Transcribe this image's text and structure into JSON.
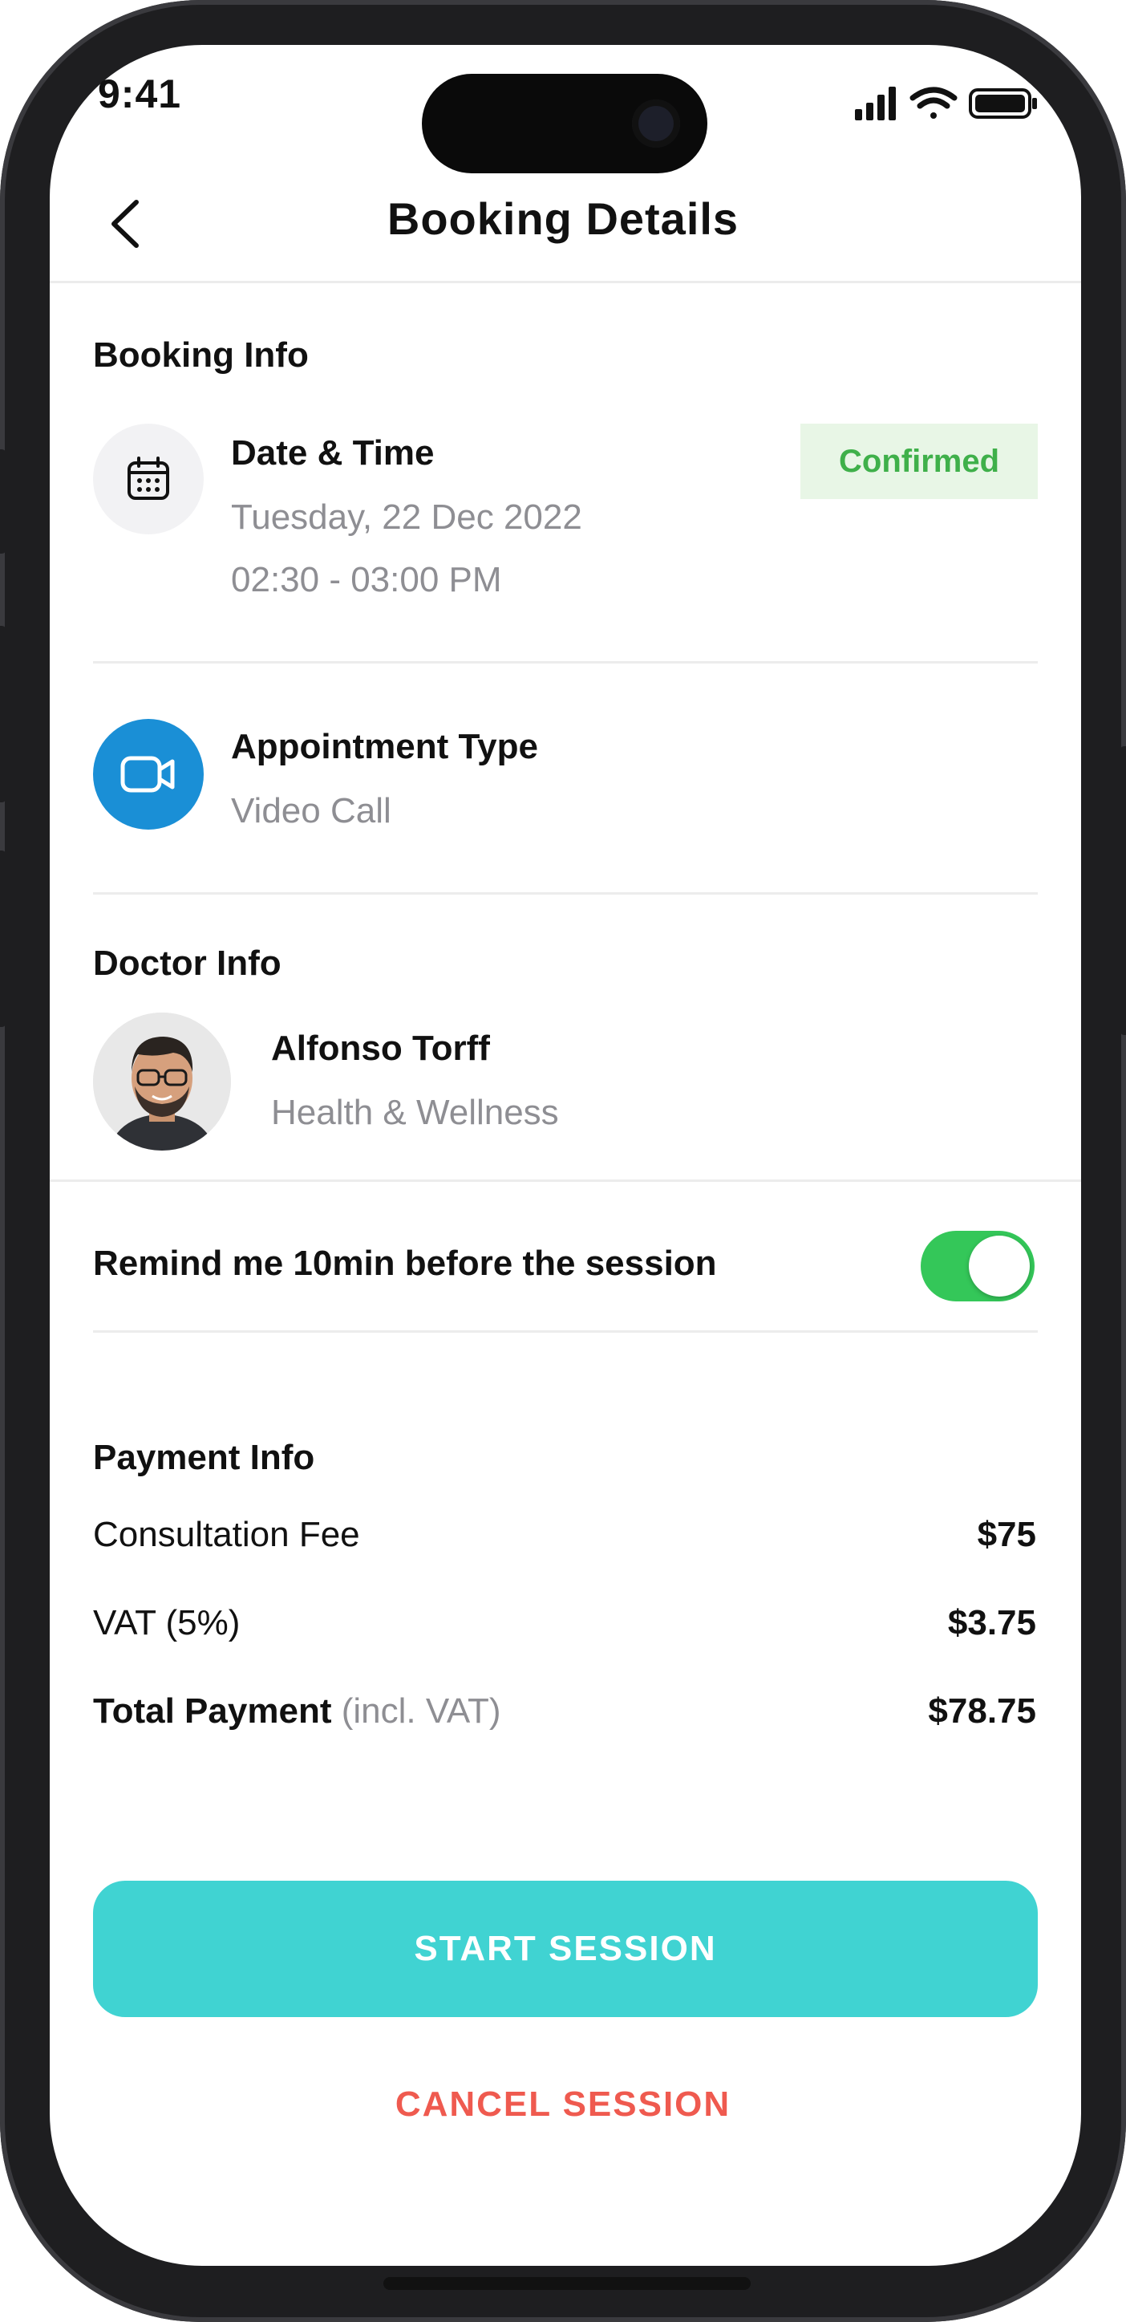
{
  "status_bar": {
    "time": "9:41"
  },
  "header": {
    "title": "Booking Details"
  },
  "booking_info": {
    "section_title": "Booking Info",
    "date_time": {
      "label": "Date & Time",
      "date": "Tuesday, 22 Dec 2022",
      "time": "02:30 - 03:00 PM",
      "status": "Confirmed"
    },
    "appointment": {
      "label": "Appointment Type",
      "value": "Video Call"
    }
  },
  "doctor_info": {
    "section_title": "Doctor Info",
    "name": "Alfonso Torff",
    "specialty": "Health & Wellness"
  },
  "reminder": {
    "label": "Remind me 10min before the session",
    "enabled": true
  },
  "payment_info": {
    "section_title": "Payment Info",
    "consultation_label": "Consultation Fee",
    "consultation_value": "$75",
    "vat_label": "VAT (5%)",
    "vat_value": "$3.75",
    "total_label": "Total Payment",
    "total_note": "(incl. VAT)",
    "total_value": "$78.75"
  },
  "actions": {
    "start_label": "START SESSION",
    "cancel_label": "CANCEL SESSION"
  },
  "colors": {
    "accent": "#40d3d2",
    "cancel": "#ef5a4f",
    "confirmed_text": "#3fb04a",
    "confirmed_bg": "#e8f6e6",
    "video_icon_bg": "#1a8fd6",
    "toggle_on": "#34c759"
  },
  "icons": [
    "back-chevron-icon",
    "calendar-icon",
    "video-camera-icon",
    "signal-icon",
    "wifi-icon",
    "battery-icon"
  ]
}
